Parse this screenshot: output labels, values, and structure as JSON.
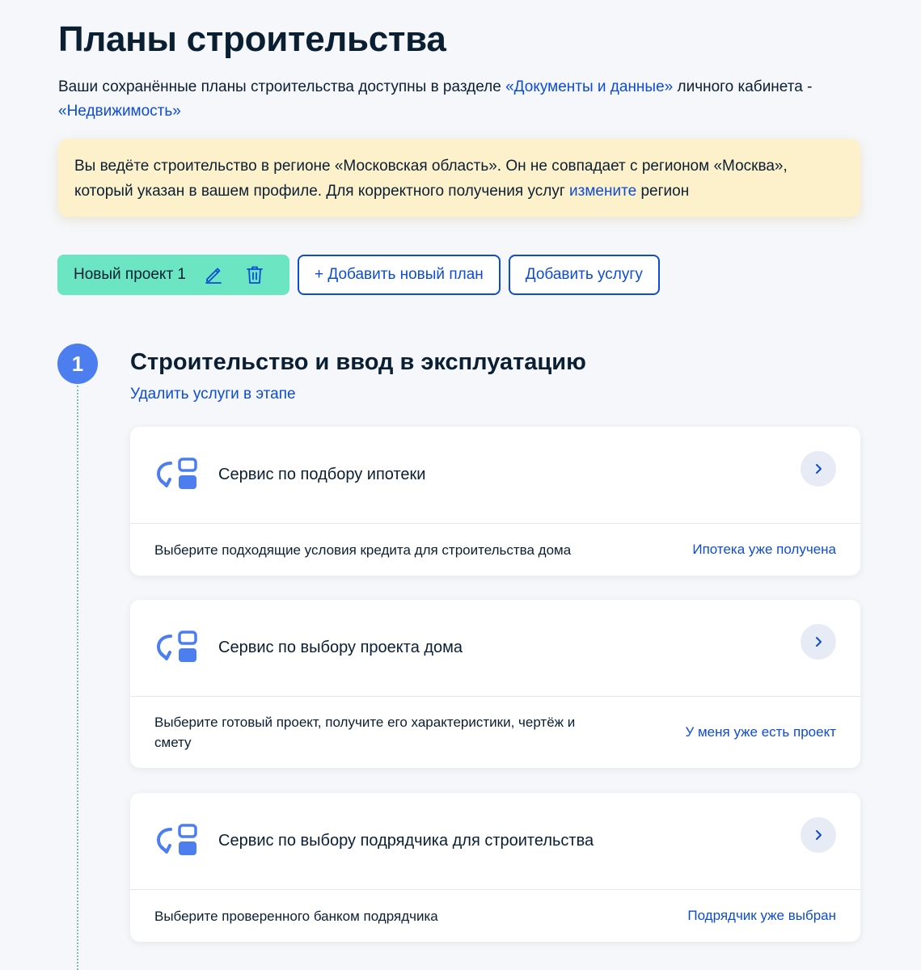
{
  "page": {
    "title": "Планы строительства",
    "intro": {
      "text_before": "Ваши сохранённые планы строительства доступны в разделе ",
      "link_documents": "«Документы и данные»",
      "text_middle": " личного кабинета - ",
      "link_realty": "«Недвижимость»"
    }
  },
  "warning": {
    "text_before": "Вы ведёте строительство в регионе «Московская область». Он не совпадает с регионом «Москва», который указан в вашем профиле. Для корректного получения услуг ",
    "link_change": "измените",
    "text_after": " регион"
  },
  "tabs": {
    "project_label": "Новый проект 1",
    "edit_icon": "pencil-icon",
    "delete_icon": "trash-icon",
    "add_plan_label": "+ Добавить новый план",
    "add_service_label": "Добавить услугу"
  },
  "stage": {
    "number": "1",
    "title": "Строительство и ввод в эксплуатацию",
    "delete_link": "Удалить услуги в этапе",
    "line_color": "#6fc2ae",
    "circle_color": "#4d7ef0"
  },
  "services": [
    {
      "icon": "service-icon",
      "title": "Сервис по подбору ипотеки",
      "description": "Выберите подходящие условия кредита для строительства дома",
      "action": "Ипотека уже получена"
    },
    {
      "icon": "service-icon",
      "title": "Сервис по выбору проекта дома",
      "description": "Выберите готовый проект, получите его характеристики, чертёж и смету",
      "action": "У меня уже есть проект"
    },
    {
      "icon": "service-icon",
      "title": "Сервис по выбору подрядчика для строительства",
      "description": "Выберите проверенного банком подрядчика",
      "action": "Подрядчик уже выбран"
    }
  ],
  "colors": {
    "accent": "#0d4cd3",
    "project_tab": "#6be5c2",
    "warning_bg": "#fdf1cc",
    "icon_blue": "#4d7ef0"
  }
}
